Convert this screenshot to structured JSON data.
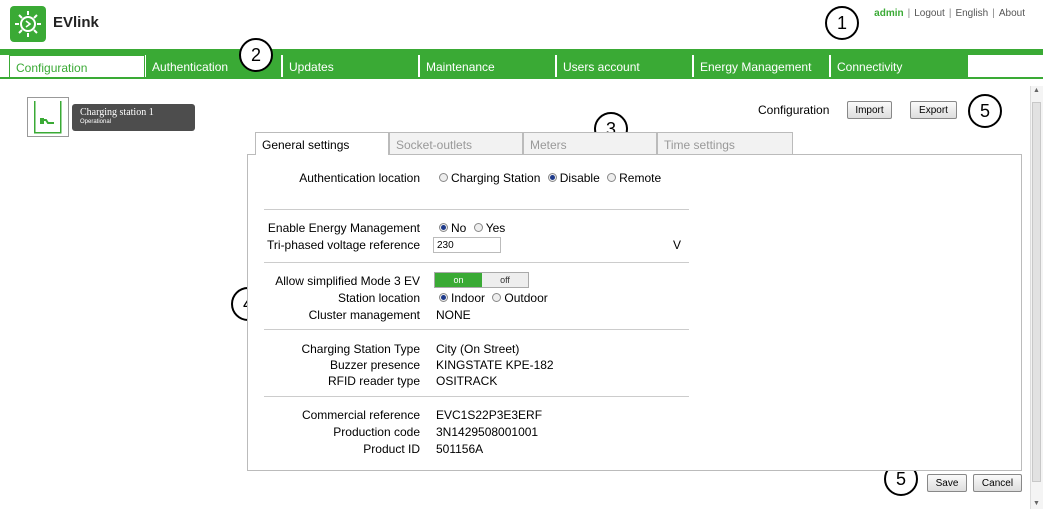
{
  "app": {
    "title": "EVlink"
  },
  "toplinks": {
    "user": "admin",
    "logout": "Logout",
    "language": "English",
    "about": "About",
    "separator": "|"
  },
  "callouts": [
    "1",
    "2",
    "3",
    "4",
    "5",
    "5"
  ],
  "nav": {
    "tabs": [
      {
        "label": "Configuration",
        "active": true
      },
      {
        "label": "Authentication"
      },
      {
        "label": "Updates"
      },
      {
        "label": "Maintenance"
      },
      {
        "label": "Users account"
      },
      {
        "label": "Energy Management"
      },
      {
        "label": "Connectivity"
      }
    ]
  },
  "station": {
    "name": "Charging station 1",
    "status": "Operational"
  },
  "config": {
    "label": "Configuration",
    "import": "Import",
    "export": "Export"
  },
  "subtabs": [
    {
      "label": "General settings",
      "active": true
    },
    {
      "label": "Socket-outlets"
    },
    {
      "label": "Meters"
    },
    {
      "label": "Time settings"
    }
  ],
  "settings": {
    "auth_location": {
      "label": "Authentication location",
      "options": [
        "Charging Station",
        "Disable",
        "Remote"
      ],
      "selected": "Disable"
    },
    "energy_mgmt": {
      "label": "Enable Energy Management",
      "options": [
        "No",
        "Yes"
      ],
      "selected": "No"
    },
    "triphase": {
      "label": "Tri-phased voltage reference",
      "value": "230",
      "unit": "V"
    },
    "mode3": {
      "label": "Allow simplified Mode 3 EV",
      "on": "on",
      "off": "off",
      "state": "on"
    },
    "station_location": {
      "label": "Station location",
      "options": [
        "Indoor",
        "Outdoor"
      ],
      "selected": "Indoor"
    },
    "cluster": {
      "label": "Cluster management",
      "value": "NONE"
    },
    "station_type": {
      "label": "Charging Station Type",
      "value": "City (On Street)"
    },
    "buzzer": {
      "label": "Buzzer presence",
      "value": "KINGSTATE KPE-182"
    },
    "rfid": {
      "label": "RFID reader type",
      "value": "OSITRACK"
    },
    "commercial_ref": {
      "label": "Commercial reference",
      "value": "EVC1S22P3E3ERF"
    },
    "production_code": {
      "label": "Production code",
      "value": "3N1429508001001"
    },
    "product_id": {
      "label": "Product ID",
      "value": "501156A"
    }
  },
  "footer": {
    "save": "Save",
    "cancel": "Cancel"
  },
  "colors": {
    "brand_green": "#3aaa35",
    "card": "#4d4d4d"
  }
}
